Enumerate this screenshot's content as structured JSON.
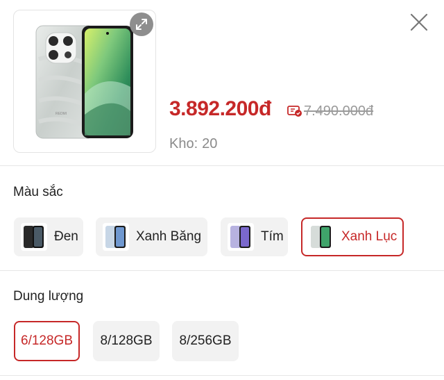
{
  "product": {
    "price": "3.892.200đ",
    "old_price": "7.490.000đ",
    "stock_label": "Kho:",
    "stock_value": "20",
    "brand_text": "REDMI"
  },
  "color_section": {
    "title": "Màu sắc",
    "options": [
      {
        "label": "Đen",
        "selected": false
      },
      {
        "label": "Xanh Băng",
        "selected": false
      },
      {
        "label": "Tím",
        "selected": false
      },
      {
        "label": "Xanh Lục",
        "selected": true
      }
    ]
  },
  "capacity_section": {
    "title": "Dung lượng",
    "options": [
      {
        "label": "6/128GB",
        "selected": true
      },
      {
        "label": "8/128GB",
        "selected": false
      },
      {
        "label": "8/256GB",
        "selected": false
      }
    ]
  },
  "colors": {
    "accent": "#c62828",
    "option_bg": "#f2f2f2"
  },
  "icons": {
    "expand": "expand-icon",
    "close": "close-icon",
    "voucher": "voucher-icon"
  }
}
